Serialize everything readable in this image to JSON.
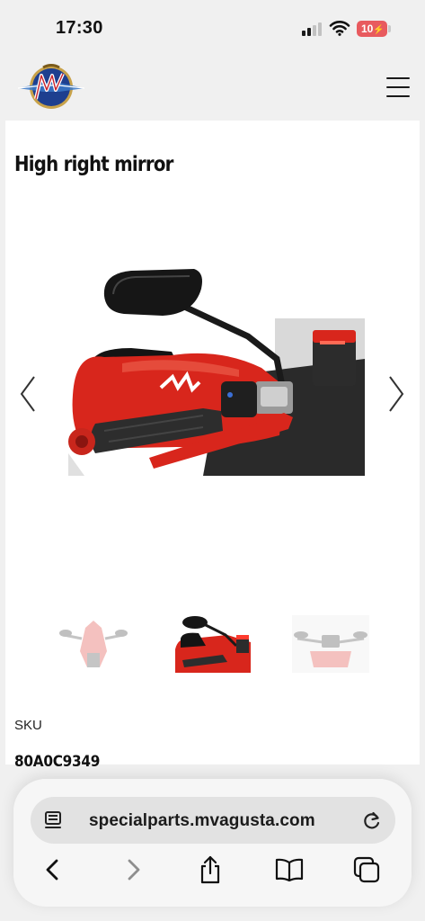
{
  "status_bar": {
    "time": "17:30",
    "battery": "10"
  },
  "header": {
    "logo_text": "MV"
  },
  "product": {
    "title": "High right mirror",
    "sku_label": "SKU",
    "sku_value": "80A0C9349"
  },
  "gallery": {
    "thumbnail_count": 3,
    "active_thumbnail": 2
  },
  "browser": {
    "url": "specialparts.mvagusta.com"
  },
  "colors": {
    "accent_red": "#d8261c",
    "battery_red": "#e85a5e"
  }
}
